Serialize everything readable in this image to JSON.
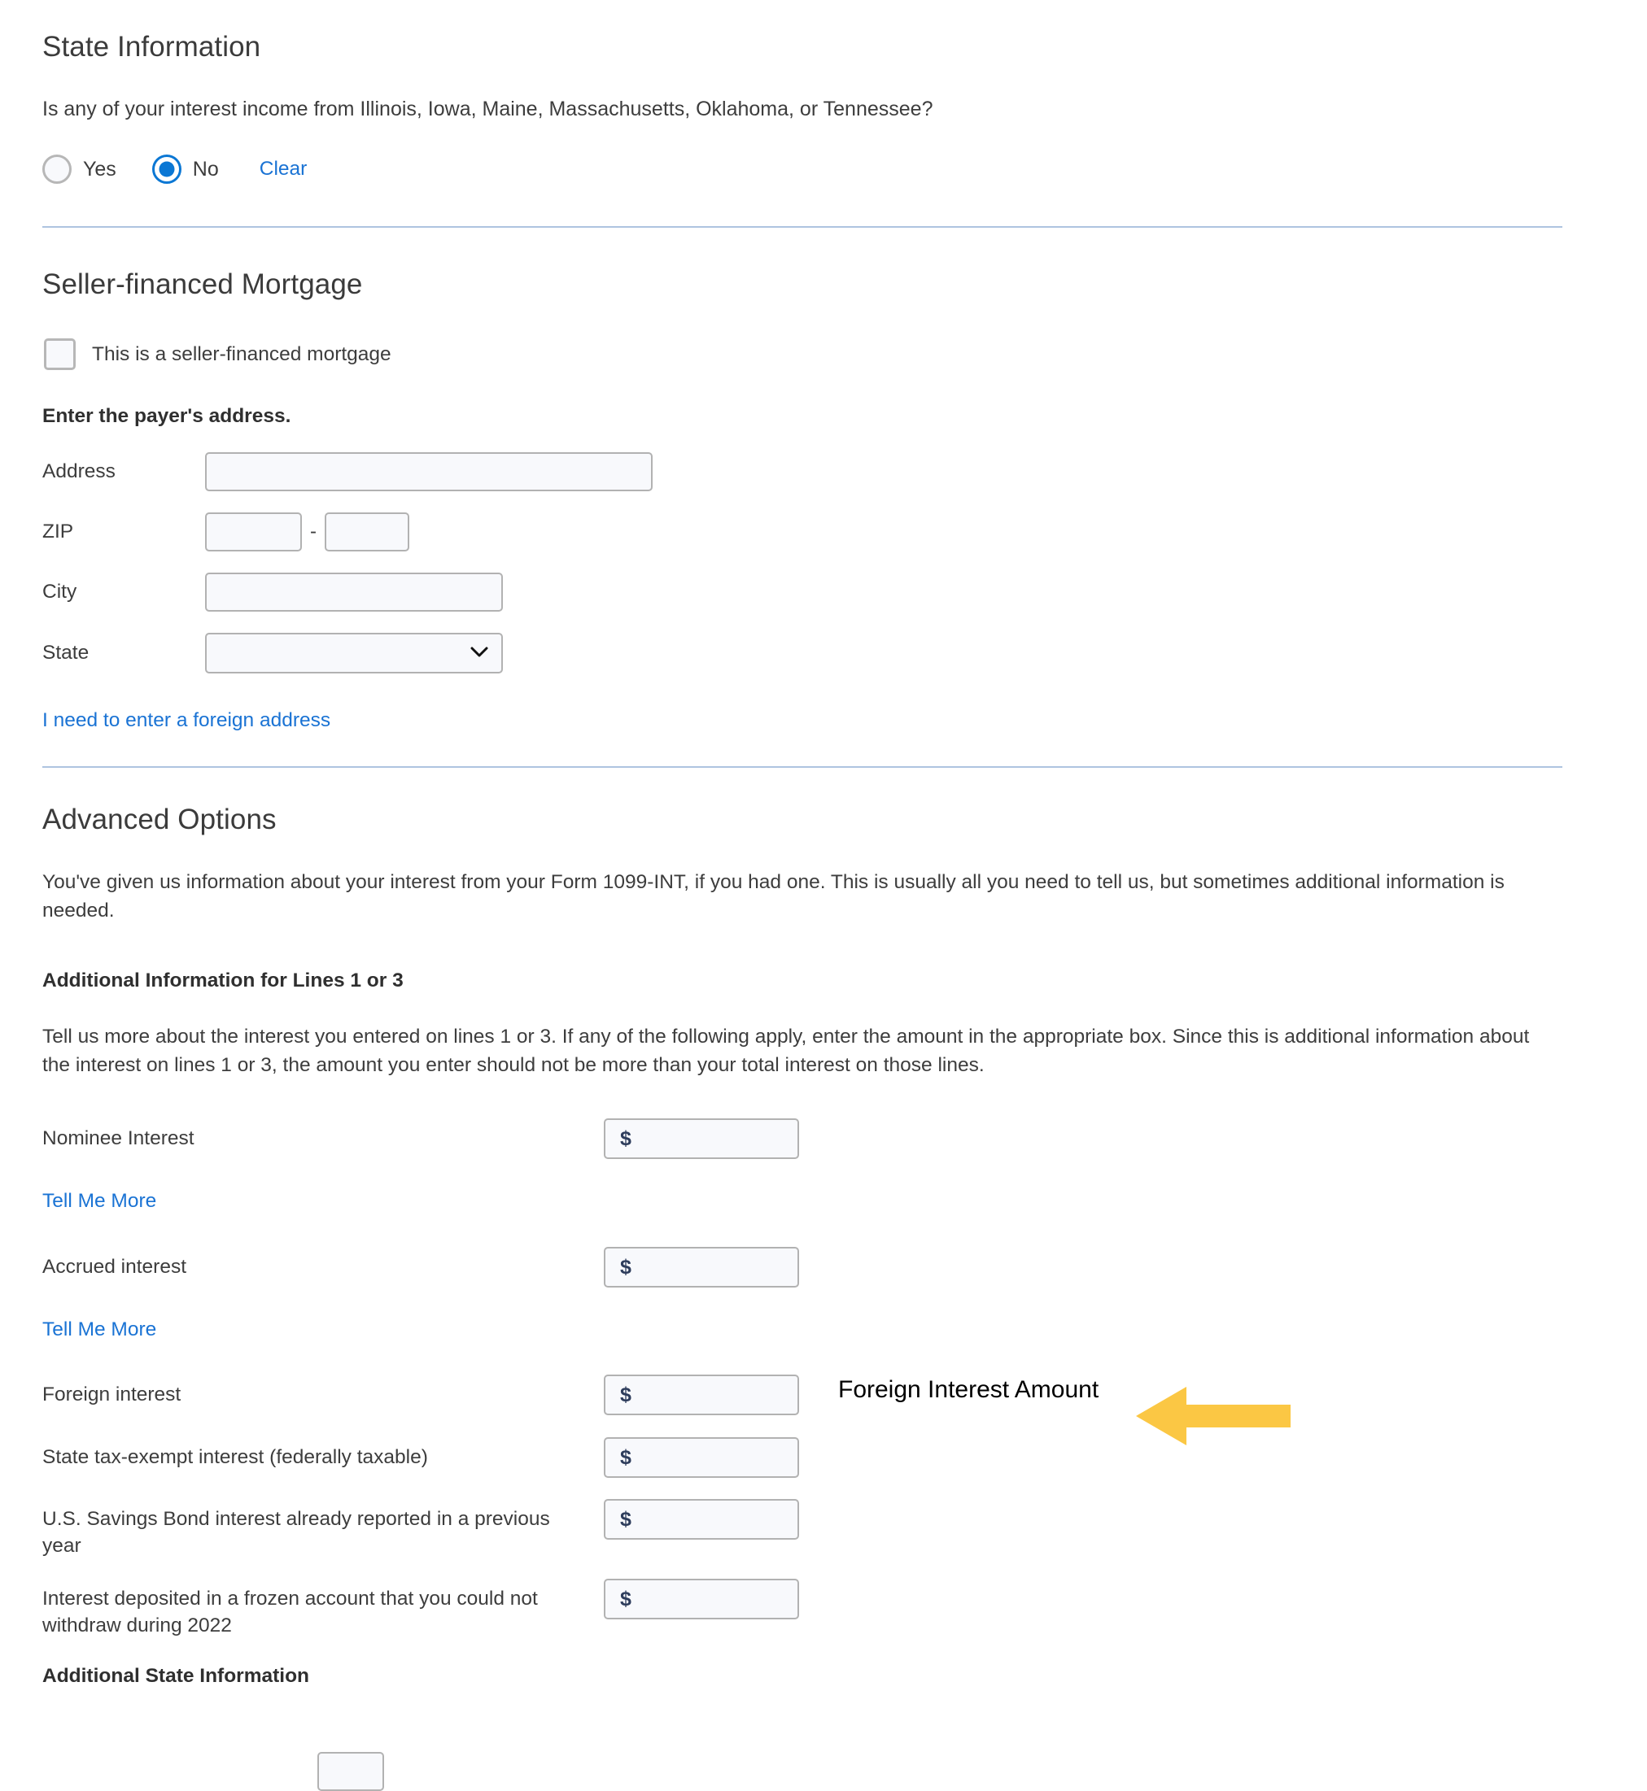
{
  "state_information": {
    "title": "State Information",
    "question": "Is any of your interest income from Illinois, Iowa, Maine, Massachusetts, Oklahoma, or Tennessee?",
    "options": [
      {
        "label": "Yes",
        "selected": false
      },
      {
        "label": "No",
        "selected": true
      }
    ],
    "clear_label": "Clear"
  },
  "seller_financed_mortgage": {
    "title": "Seller-financed Mortgage",
    "checkbox_label": "This is a seller-financed mortgage",
    "checkbox_checked": false,
    "address_instruction": "Enter the payer's address.",
    "fields": {
      "address_label": "Address",
      "address_value": "",
      "zip_label": "ZIP",
      "zip_first_value": "",
      "zip_second_value": "",
      "zip_separator": "-",
      "city_label": "City",
      "city_value": "",
      "state_label": "State",
      "state_value": "",
      "state_options": [
        ""
      ]
    },
    "foreign_address_link": "I need to enter a foreign address"
  },
  "advanced_options": {
    "title": "Advanced Options",
    "intro": "You've given us information about your interest from your Form 1099-INT, if you had one. This is usually all you need to tell us, but sometimes additional information is needed.",
    "lines_heading": "Additional Information for Lines 1 or 3",
    "lines_description": "Tell us more about the interest you entered on lines 1 or 3. If any of the following apply, enter the amount in the appropriate box. Since this is additional information about the interest on lines 1 or 3, the amount you enter should not be more than your total interest on those lines.",
    "currency_symbol": "$",
    "tell_me_more_label": "Tell Me More",
    "rows": [
      {
        "label": "Nominee Interest",
        "value": "",
        "help_link": "Tell Me More"
      },
      {
        "label": "Accrued interest",
        "value": "",
        "help_link": "Tell Me More"
      },
      {
        "label": "Foreign interest",
        "value": "",
        "help_link": ""
      },
      {
        "label": "State tax-exempt interest (federally taxable)",
        "value": "",
        "help_link": ""
      },
      {
        "label": "U.S. Savings Bond interest already reported in a previous year",
        "value": "",
        "help_link": ""
      },
      {
        "label": "Interest deposited in a frozen account that you could not withdraw during 2022",
        "value": "",
        "help_link": ""
      }
    ],
    "additional_state_heading": "Additional State Information"
  },
  "annotation": {
    "text": "Foreign Interest Amount",
    "arrow_direction": "left",
    "arrow_color": "#FBC744",
    "target": "Foreign interest amount input"
  },
  "colors": {
    "link": "#1a73d4",
    "radio_accent": "#0b77d4",
    "divider": "#aec4e0",
    "input_bg": "#f8f9fc",
    "input_border": "#b2b2b2",
    "text": "#3d3d3d",
    "annotation_arrow": "#FBC744"
  }
}
